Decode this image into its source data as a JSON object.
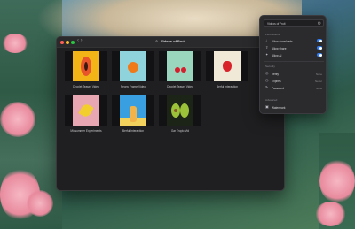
{
  "window": {
    "title": "Videos of Fruit",
    "nav_arrows": "‹ ›",
    "items": [
      {
        "caption": "Droplet Teaser Video",
        "art": "papaya"
      },
      {
        "caption": "Peony Frame Video",
        "art": "orange"
      },
      {
        "caption": "Droplet Teaser Video",
        "art": "cherry"
      },
      {
        "caption": "Berful Interaction",
        "art": "straw"
      },
      {
        "caption": "Midsummer Experiments",
        "art": "banana"
      },
      {
        "caption": "Berful Interaction",
        "art": "stack"
      },
      {
        "caption": "Gar Tropic Vid",
        "art": "avocado"
      }
    ]
  },
  "panel": {
    "search_value": "Videos of Fruit",
    "sections": [
      {
        "label": "Permissions",
        "rows": [
          {
            "label": "Allow downloads",
            "kind": "toggle",
            "on": true
          },
          {
            "label": "Allow share",
            "kind": "toggle",
            "on": true
          },
          {
            "label": "Allow AI",
            "kind": "toggle",
            "on": true
          }
        ]
      },
      {
        "label": "Security",
        "rows": [
          {
            "label": "Verify",
            "kind": "value",
            "value": "None"
          },
          {
            "label": "Expires",
            "kind": "value",
            "value": "Never"
          },
          {
            "label": "Password",
            "kind": "value",
            "value": "None"
          }
        ]
      },
      {
        "label": "Advanced",
        "rows": [
          {
            "label": "Watermark",
            "kind": "value",
            "value": ""
          }
        ]
      }
    ]
  }
}
